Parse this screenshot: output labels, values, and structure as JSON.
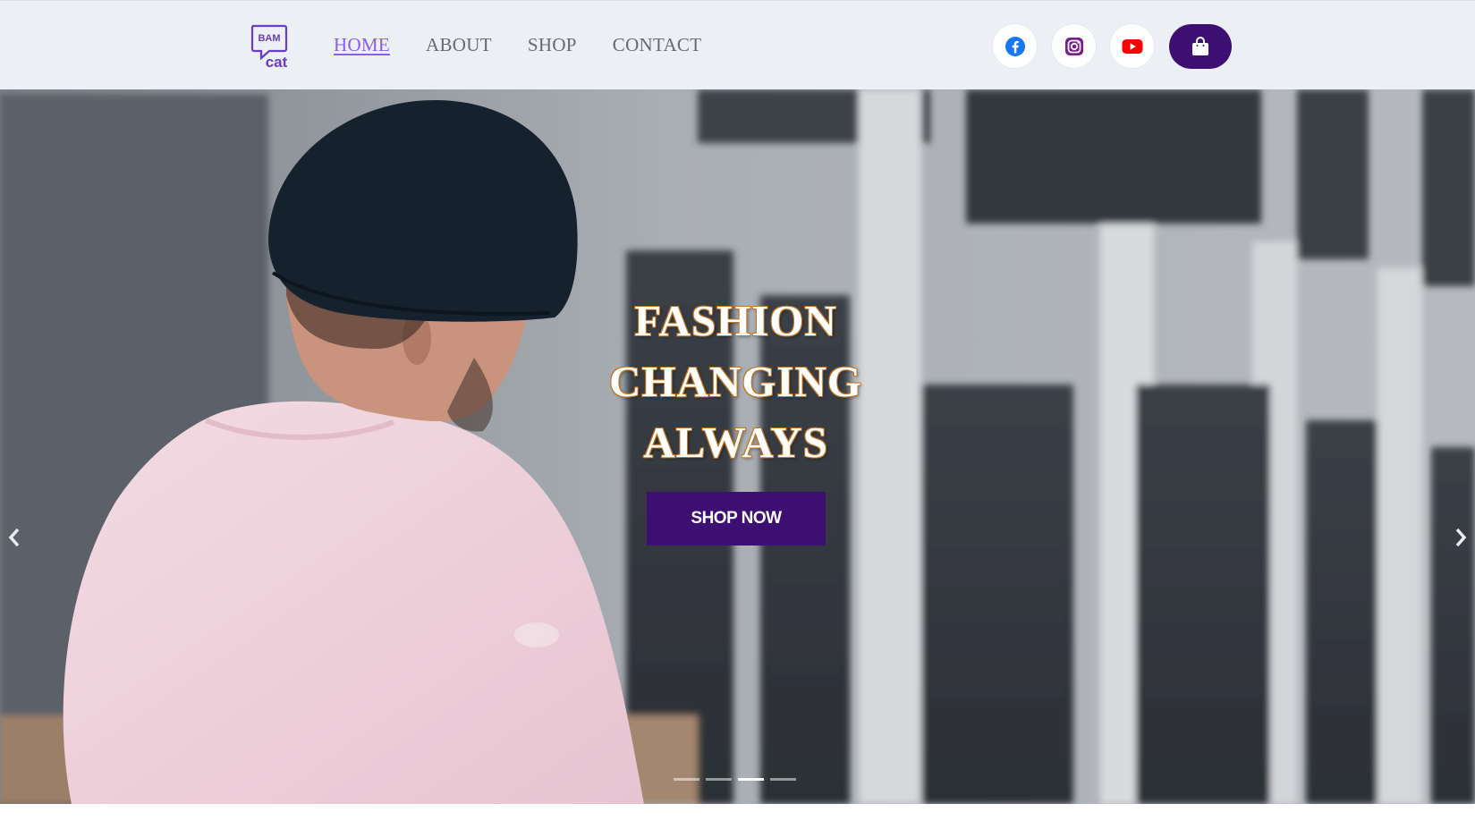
{
  "brand": {
    "logo_line1": "BAM",
    "logo_line2": "cat",
    "accent": "#8a5cf0",
    "primary": "#3e0f73"
  },
  "nav": {
    "links": [
      {
        "label": "HOME",
        "active": true
      },
      {
        "label": "ABOUT",
        "active": false
      },
      {
        "label": "SHOP",
        "active": false
      },
      {
        "label": "CONTACT",
        "active": false
      }
    ],
    "social": [
      {
        "icon": "facebook-icon",
        "color": "#1877f2"
      },
      {
        "icon": "instagram-icon",
        "color": "#7a1a8f"
      },
      {
        "icon": "youtube-icon",
        "color": "#ff0000"
      }
    ],
    "cart_icon": "shopping-bag-icon"
  },
  "hero": {
    "title_lines": [
      "FASHION",
      "CHANGING",
      "ALWAYS"
    ],
    "cta_label": "SHOP NOW",
    "prev_icon": "chevron-left-icon",
    "next_icon": "chevron-right-icon",
    "slide_count": 4,
    "active_slide": 3
  }
}
